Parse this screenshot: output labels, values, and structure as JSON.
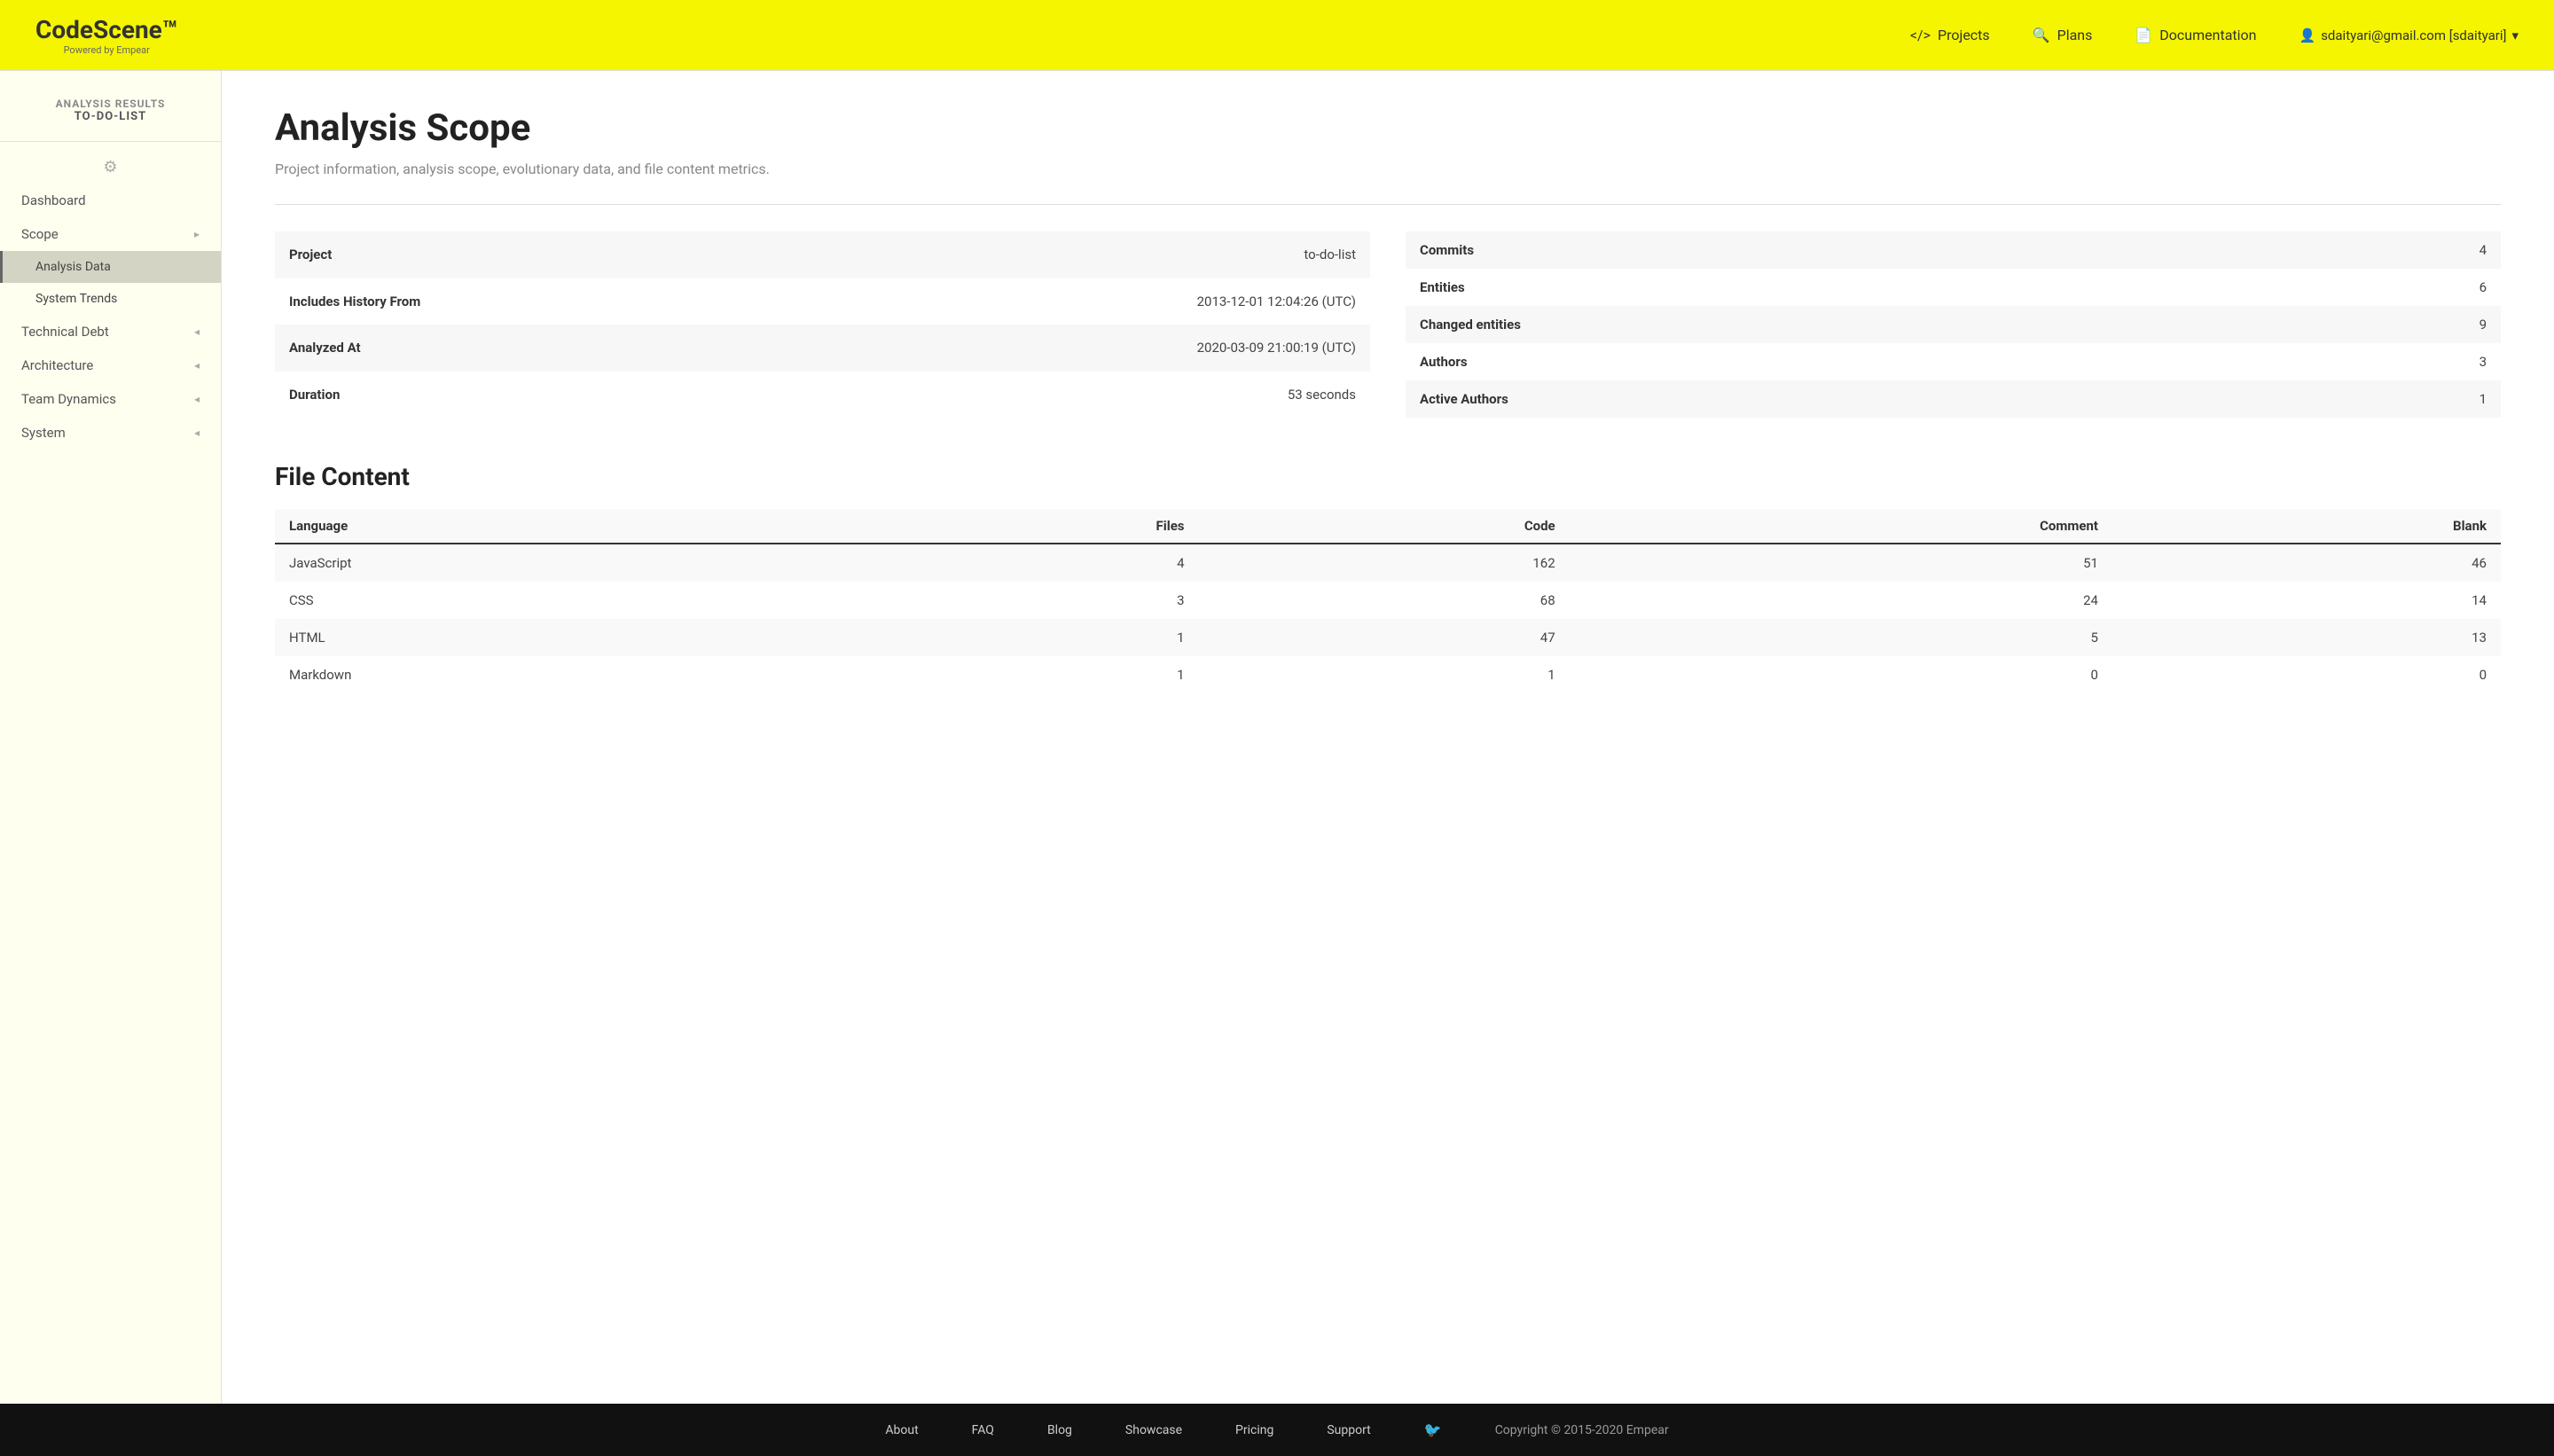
{
  "header": {
    "logo_title": "CodeScene™",
    "logo_powered": "Powered by Empear",
    "nav": {
      "projects_label": "Projects",
      "plans_label": "Plans",
      "documentation_label": "Documentation",
      "user_label": "sdaityari@gmail.com [sdaityari]"
    }
  },
  "sidebar": {
    "analysis_results_label": "ANALYSIS RESULTS",
    "project_name_label": "TO-DO-LIST",
    "items": [
      {
        "id": "dashboard",
        "label": "Dashboard",
        "has_chevron": false
      },
      {
        "id": "scope",
        "label": "Scope",
        "has_chevron": true
      },
      {
        "id": "analysis-data",
        "label": "Analysis Data",
        "is_sub": true,
        "active": true
      },
      {
        "id": "system-trends",
        "label": "System Trends",
        "is_sub": true
      },
      {
        "id": "technical-debt",
        "label": "Technical Debt",
        "has_chevron": true
      },
      {
        "id": "architecture",
        "label": "Architecture",
        "has_chevron": true
      },
      {
        "id": "team-dynamics",
        "label": "Team Dynamics",
        "has_chevron": true
      },
      {
        "id": "system",
        "label": "System",
        "has_chevron": true
      }
    ]
  },
  "main": {
    "page_title": "Analysis Scope",
    "page_subtitle": "Project information, analysis scope, evolutionary data, and file content metrics.",
    "project_info": {
      "rows": [
        {
          "label": "Project",
          "value": "to-do-list"
        },
        {
          "label": "Includes History From",
          "value": "2013-12-01 12:04:26 (UTC)"
        },
        {
          "label": "Analyzed At",
          "value": "2020-03-09 21:00:19 (UTC)"
        },
        {
          "label": "Duration",
          "value": "53 seconds"
        }
      ]
    },
    "stats_info": {
      "rows": [
        {
          "label": "Commits",
          "value": "4"
        },
        {
          "label": "Entities",
          "value": "6"
        },
        {
          "label": "Changed entities",
          "value": "9"
        },
        {
          "label": "Authors",
          "value": "3"
        },
        {
          "label": "Active Authors",
          "value": "1"
        }
      ]
    },
    "file_content": {
      "section_title": "File Content",
      "columns": [
        "Language",
        "Files",
        "Code",
        "Comment",
        "Blank"
      ],
      "rows": [
        {
          "language": "JavaScript",
          "files": "4",
          "code": "162",
          "comment": "51",
          "blank": "46"
        },
        {
          "language": "CSS",
          "files": "3",
          "code": "68",
          "comment": "24",
          "blank": "14"
        },
        {
          "language": "HTML",
          "files": "1",
          "code": "47",
          "comment": "5",
          "blank": "13"
        },
        {
          "language": "Markdown",
          "files": "1",
          "code": "1",
          "comment": "0",
          "blank": "0"
        }
      ]
    }
  },
  "footer": {
    "links": [
      {
        "id": "about",
        "label": "About"
      },
      {
        "id": "faq",
        "label": "FAQ"
      },
      {
        "id": "blog",
        "label": "Blog"
      },
      {
        "id": "showcase",
        "label": "Showcase"
      },
      {
        "id": "pricing",
        "label": "Pricing"
      },
      {
        "id": "support",
        "label": "Support"
      }
    ],
    "copyright": "Copyright © 2015-2020 Empear"
  }
}
